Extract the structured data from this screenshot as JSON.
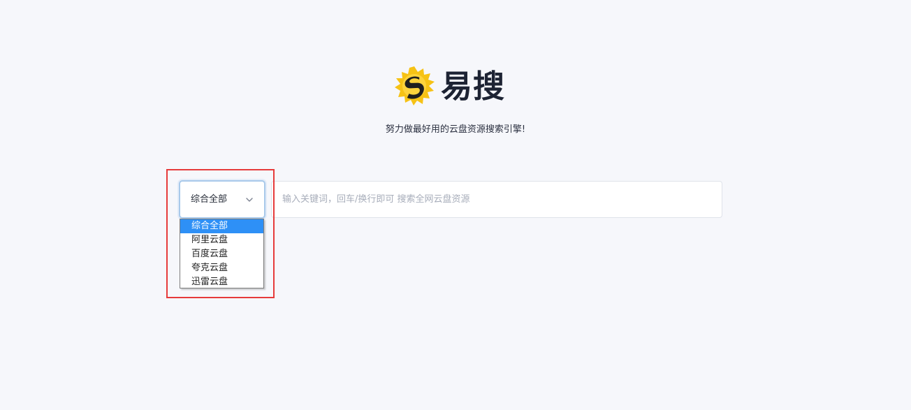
{
  "brand": {
    "name": "易搜",
    "logo_letter": "S",
    "logo_icon": "sun-s-logo-icon"
  },
  "tagline": "努力做最好用的云盘资源搜索引擎!",
  "search": {
    "scope_selected": "综合全部",
    "placeholder": "输入关键词，回车/换行即可 搜索全网云盘资源",
    "value": ""
  },
  "dropdown": {
    "options": [
      "综合全部",
      "阿里云盘",
      "百度云盘",
      "夸克云盘",
      "迅雷云盘"
    ],
    "selected_index": 0
  },
  "colors": {
    "accent": "#2e90f6",
    "highlight": "#e63b3b",
    "logo_yellow": "#f5c414",
    "logo_dark": "#1f1f1f"
  }
}
